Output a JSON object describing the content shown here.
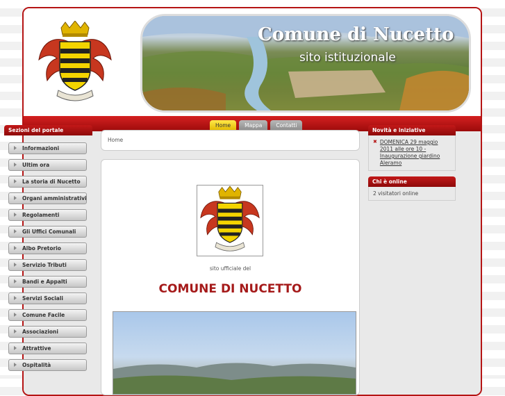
{
  "header": {
    "title": "Comune di Nucetto",
    "subtitle": "sito istituzionale"
  },
  "nav": {
    "tabs": [
      {
        "label": "Home",
        "active": true
      },
      {
        "label": "Mappa",
        "active": false
      },
      {
        "label": "Contatti",
        "active": false
      }
    ]
  },
  "sidebar": {
    "heading": "Sezioni del portale",
    "items": [
      {
        "label": "Informazioni"
      },
      {
        "label": "Ultim ora"
      },
      {
        "label": "La storia di Nucetto"
      },
      {
        "label": "Organi amministrativi"
      },
      {
        "label": "Regolamenti"
      },
      {
        "label": "Gli Uffici Comunali"
      },
      {
        "label": "Albo Pretorio"
      },
      {
        "label": "Servizio Tributi"
      },
      {
        "label": "Bandi e Appalti"
      },
      {
        "label": "Servizi Sociali"
      },
      {
        "label": "Comune Facile"
      },
      {
        "label": "Associazioni"
      },
      {
        "label": "Attrattive"
      },
      {
        "label": "Ospitalità"
      }
    ]
  },
  "breadcrumb": {
    "label": "Home"
  },
  "main": {
    "sito_text": "sito ufficiale del",
    "comune_text": "COMUNE DI NUCETTO"
  },
  "right": {
    "news_heading": "Novità e iniziative",
    "news_item": "DOMENICA 29 maggio 2011 alle ore 10 - Inaugurazione giardino Aleramo",
    "online_heading": "Chi è online",
    "online_text": "2 visitatori online"
  },
  "colors": {
    "accent_red": "#b51414",
    "active_tab": "#f0c800",
    "page_title_red": "#a51a1a"
  }
}
